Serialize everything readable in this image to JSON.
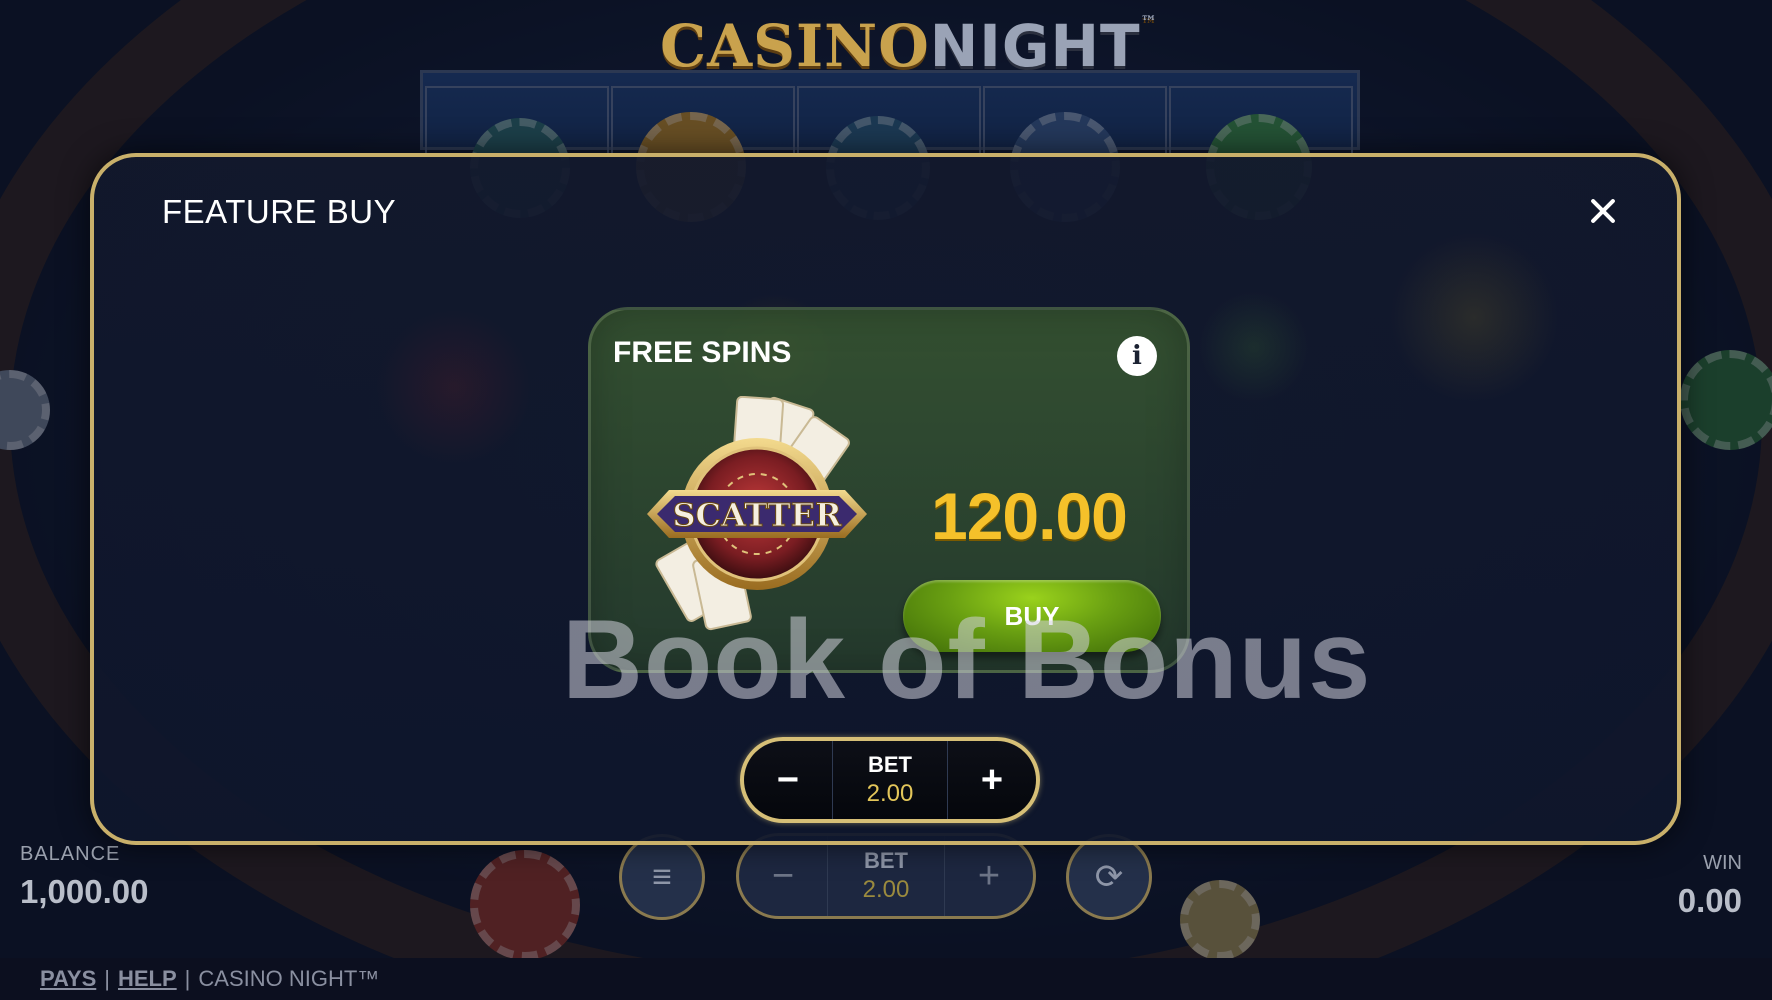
{
  "game": {
    "logo_main": "CASINO",
    "logo_accent": "NIGHT",
    "logo_tm": "™"
  },
  "hud": {
    "balance_label": "BALANCE",
    "balance_value": "1,000.00",
    "win_label": "WIN",
    "win_value": "0.00",
    "bet_label": "BET",
    "bet_value": "2.00",
    "minus": "−",
    "plus": "+",
    "menu_icon": "≡",
    "autoplay_icon": "⟳"
  },
  "footer": {
    "pays": "PAYS",
    "help": "HELP",
    "separator": "|",
    "game_name": "CASINO NIGHT™"
  },
  "modal": {
    "title": "FEATURE BUY",
    "close_icon": "close-icon",
    "card": {
      "title": "FREE SPINS",
      "info": "i",
      "scatter_text": "SCATTER",
      "price": "120.00",
      "buy_label": "BUY"
    },
    "watermark": "Book of Bonus",
    "bet": {
      "label": "BET",
      "value": "2.00",
      "minus": "−",
      "plus": "+"
    }
  },
  "colors": {
    "accent_gold": "#c9b06a",
    "price_yellow": "#f5c12a",
    "buy_green": "#6aa012"
  }
}
